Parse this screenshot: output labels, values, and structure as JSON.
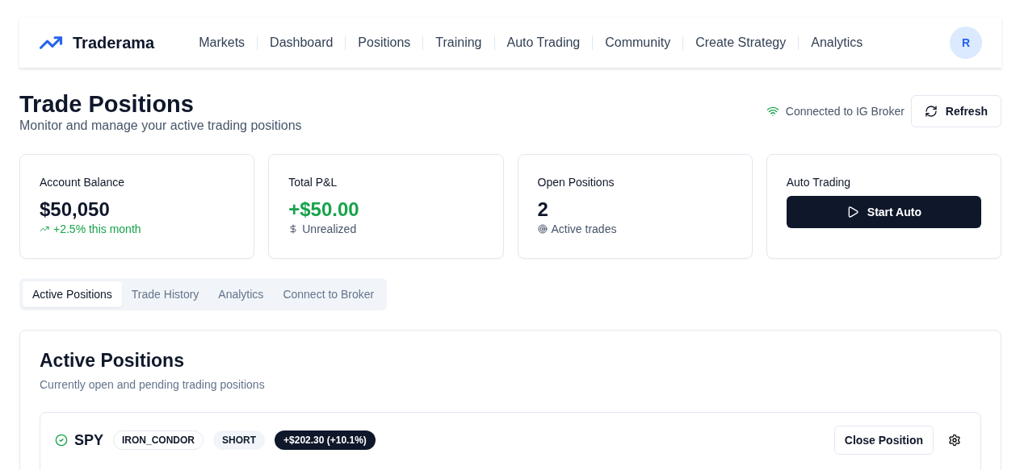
{
  "brand": {
    "name": "Traderama"
  },
  "nav": [
    {
      "label": "Markets"
    },
    {
      "label": "Dashboard"
    },
    {
      "label": "Positions"
    },
    {
      "label": "Training"
    },
    {
      "label": "Auto Trading"
    },
    {
      "label": "Community"
    },
    {
      "label": "Create Strategy"
    },
    {
      "label": "Analytics"
    }
  ],
  "avatar": {
    "initial": "R"
  },
  "header": {
    "title": "Trade Positions",
    "subtitle": "Monitor and manage your active trading positions",
    "connection": "Connected to IG Broker",
    "refresh": "Refresh"
  },
  "stats": [
    {
      "kind": "stat",
      "label": "Account Balance",
      "value": "$50,050",
      "note": "+2.5% this month"
    },
    {
      "kind": "stat",
      "label": "Total P&L",
      "value": "+$50.00",
      "note": "Unrealized"
    },
    {
      "kind": "stat",
      "label": "Open Positions",
      "value": "2",
      "note": "Active trades"
    },
    {
      "kind": "action",
      "label": "Auto Trading",
      "button": "Start Auto"
    }
  ],
  "tabs": [
    {
      "label": "Active Positions",
      "selected": true
    },
    {
      "label": "Trade History",
      "selected": false
    },
    {
      "label": "Analytics",
      "selected": false
    },
    {
      "label": "Connect to Broker",
      "selected": false
    }
  ],
  "panel": {
    "title": "Active Positions",
    "subtitle": "Currently open and pending trading positions",
    "positions": [
      {
        "symbol": "SPY",
        "strategy": "IRON_CONDOR",
        "side": "SHORT",
        "pnl": "+$202.30 (+10.1%)",
        "close": "Close Position"
      }
    ]
  }
}
